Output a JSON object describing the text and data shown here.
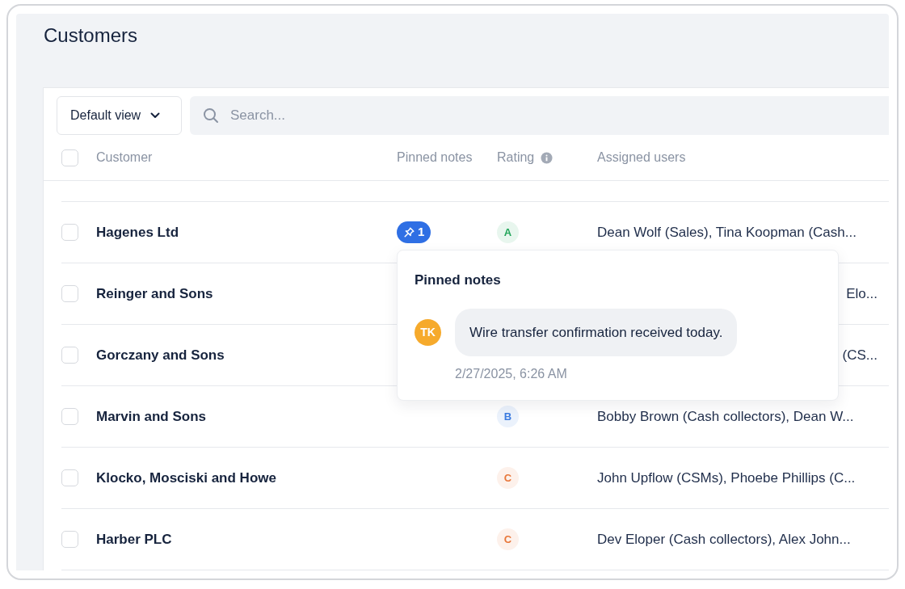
{
  "page": {
    "title": "Customers"
  },
  "toolbar": {
    "view_button": "Default view",
    "search": {
      "placeholder": "Search..."
    }
  },
  "table": {
    "header_checkbox": {
      "checked": false
    },
    "columns": [
      "Customer",
      "Pinned notes",
      "Rating",
      "Assigned users"
    ],
    "rows": [
      {
        "checked": false,
        "customer": "Hagenes Ltd",
        "pinned_count": "1",
        "rating": {
          "letter": "A",
          "color": "#22a55a"
        },
        "assigned": "Dean Wolf (Sales), Tina Koopman (Cash..."
      },
      {
        "checked": false,
        "customer": "Reinger and Sons",
        "assigned": "Elo..."
      },
      {
        "checked": false,
        "customer": "Gorczany and Sons",
        "assigned": "(CS..."
      },
      {
        "checked": false,
        "customer": "Marvin and Sons",
        "rating": {
          "letter": "B",
          "color": "#3b7be0"
        },
        "assigned": "Bobby Brown (Cash collectors), Dean W..."
      },
      {
        "checked": false,
        "customer": "Klocko, Mosciski and Howe",
        "rating": {
          "letter": "C",
          "color": "#e8773a"
        },
        "assigned": "John Upflow (CSMs), Phoebe Phillips (C..."
      },
      {
        "checked": false,
        "customer": "Harber PLC",
        "rating": {
          "letter": "C",
          "color": "#e8773a"
        },
        "assigned": "Dev Eloper (Cash collectors), Alex John..."
      }
    ]
  },
  "popover": {
    "title": "Pinned notes",
    "notes": [
      {
        "initials": "TK",
        "text": "Wire transfer confirmation received today.",
        "time": "2/27/2025, 6:26 AM"
      }
    ]
  }
}
